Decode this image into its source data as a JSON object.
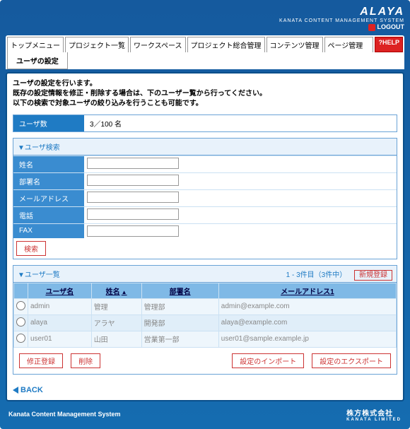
{
  "header": {
    "brand": "ALAYA",
    "brand_sub": "KANATA CONTENT MANAGEMENT SYSTEM",
    "logout": "LOGOUT"
  },
  "tabs": [
    "トップメニュー",
    "プロジェクト一覧",
    "ワークスペース",
    "プロジェクト総合管理",
    "コンテンツ管理",
    "ページ管理"
  ],
  "help": "HELP",
  "subtab": "ユーザの設定",
  "intro": {
    "line1": "ユーザの設定を行います。",
    "line2": "既存の設定情報を修正・削除する場合は、下のユーザー覧から行ってください。",
    "line3": "以下の検索で対象ユーザの絞り込みを行うことも可能です。"
  },
  "count": {
    "label": "ユーザ数",
    "value": "3／100 名"
  },
  "search": {
    "heading": "▼ユーザ検索",
    "fields": {
      "name": "姓名",
      "dept": "部署名",
      "mail": "メールアドレス",
      "tel": "電話",
      "fax": "FAX"
    },
    "button": "検索"
  },
  "list": {
    "heading": "▼ユーザ一覧",
    "range": "1 - 3件目（3件中）",
    "newreg": "新規登録",
    "cols": {
      "user": "ユーザ名",
      "name": "姓名",
      "dept": "部署名",
      "mail": "メールアドレス1"
    },
    "rows": [
      {
        "user": "admin",
        "name": "管理",
        "dept": "管理部",
        "mail": "admin@example.com"
      },
      {
        "user": "alaya",
        "name": "アラヤ",
        "dept": "開発部",
        "mail": "alaya@example.com"
      },
      {
        "user": "user01",
        "name": "山田",
        "dept": "営業第一部",
        "mail": "user01@sample.example.jp"
      }
    ],
    "buttons": {
      "edit": "修正登録",
      "del": "削除",
      "import": "設定のインポート",
      "export": "設定のエクスポート"
    }
  },
  "back": "BACK",
  "footer": {
    "left": "Kanata Content Management System",
    "company": "株方株式会社",
    "company_sub": "KANATA LIMITED"
  }
}
